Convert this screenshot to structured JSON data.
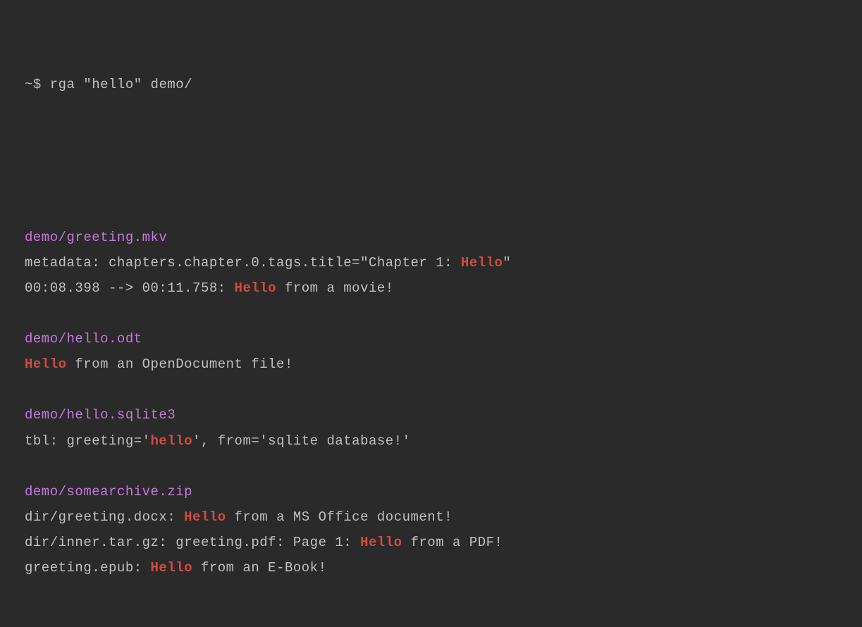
{
  "prompt": {
    "symbol": "~$ ",
    "command": "rga \"hello\" demo/"
  },
  "results": [
    {
      "file": "demo/greeting.mkv",
      "lines": [
        {
          "segments": [
            {
              "t": "text",
              "v": "metadata: chapters.chapter.0.tags.title=\"Chapter 1: "
            },
            {
              "t": "hl",
              "v": "Hello"
            },
            {
              "t": "text",
              "v": "\""
            }
          ]
        },
        {
          "segments": [
            {
              "t": "text",
              "v": "00:08.398 --> 00:11.758: "
            },
            {
              "t": "hl",
              "v": "Hello"
            },
            {
              "t": "text",
              "v": " from a movie!"
            }
          ]
        }
      ]
    },
    {
      "file": "demo/hello.odt",
      "lines": [
        {
          "segments": [
            {
              "t": "hl",
              "v": "Hello"
            },
            {
              "t": "text",
              "v": " from an OpenDocument file!"
            }
          ]
        }
      ]
    },
    {
      "file": "demo/hello.sqlite3",
      "lines": [
        {
          "segments": [
            {
              "t": "text",
              "v": "tbl: greeting='"
            },
            {
              "t": "hl",
              "v": "hello"
            },
            {
              "t": "text",
              "v": "', from='sqlite database!'"
            }
          ]
        }
      ]
    },
    {
      "file": "demo/somearchive.zip",
      "lines": [
        {
          "segments": [
            {
              "t": "text",
              "v": "dir/greeting.docx: "
            },
            {
              "t": "hl",
              "v": "Hello"
            },
            {
              "t": "text",
              "v": " from a MS Office document!"
            }
          ]
        },
        {
          "segments": [
            {
              "t": "text",
              "v": "dir/inner.tar.gz: greeting.pdf: Page 1: "
            },
            {
              "t": "hl",
              "v": "Hello"
            },
            {
              "t": "text",
              "v": " from a PDF!"
            }
          ]
        },
        {
          "segments": [
            {
              "t": "text",
              "v": "greeting.epub: "
            },
            {
              "t": "hl",
              "v": "Hello"
            },
            {
              "t": "text",
              "v": " from an E-Book!"
            }
          ]
        }
      ]
    }
  ]
}
